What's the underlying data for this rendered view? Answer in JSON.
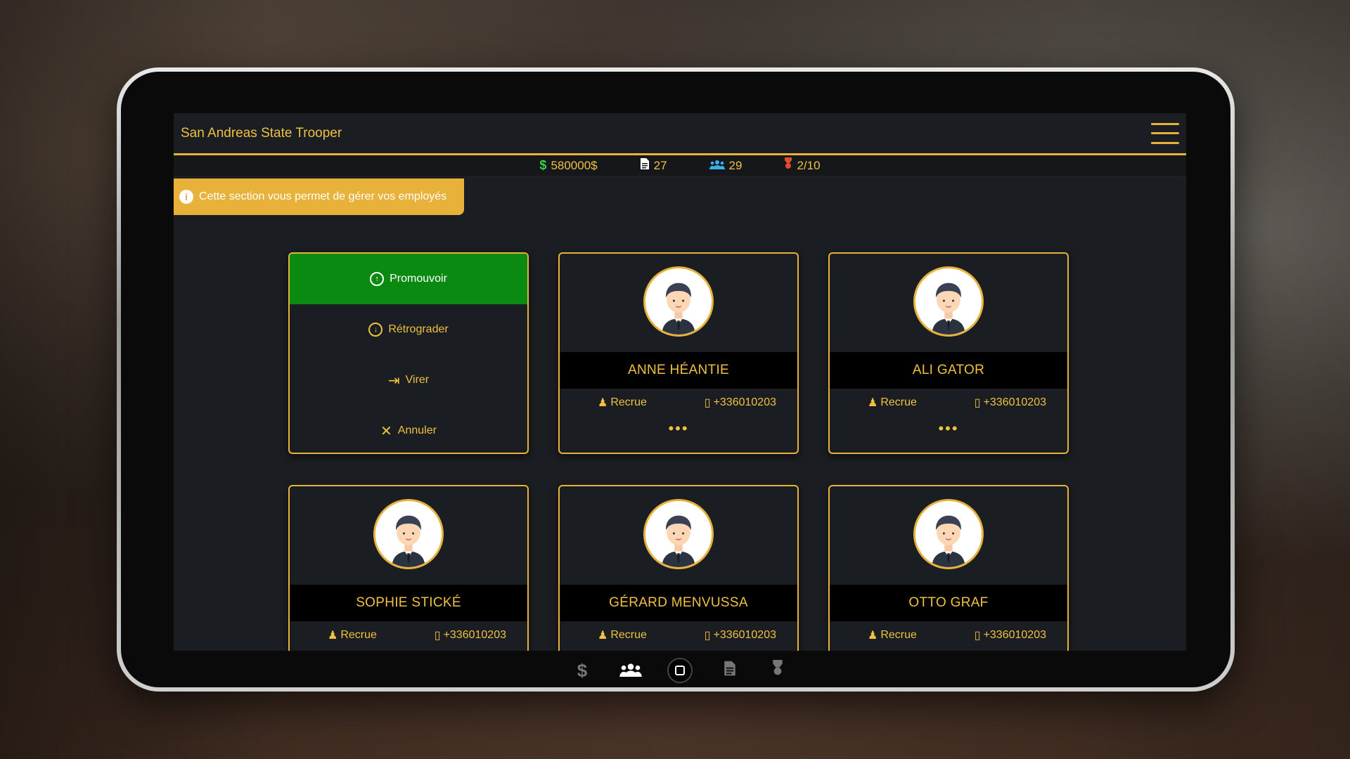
{
  "app": {
    "title": "San Andreas State Trooper"
  },
  "stats": {
    "money": "580000$",
    "documents": "27",
    "members": "29",
    "ranks": "2/10"
  },
  "banner": {
    "text": "Cette section vous permet de gérer vos employés"
  },
  "actions": {
    "promote": "Promouvoir",
    "demote": "Rétrograder",
    "fire": "Virer",
    "cancel": "Annuler"
  },
  "employees": [
    {
      "name": "ANNE HÉANTIE",
      "rank": "Recrue",
      "phone": "+336010203",
      "more": "•••"
    },
    {
      "name": "ALI GATOR",
      "rank": "Recrue",
      "phone": "+336010203",
      "more": "•••"
    },
    {
      "name": "SOPHIE STICKÉ",
      "rank": "Recrue",
      "phone": "+336010203",
      "more": "•••"
    },
    {
      "name": "GÉRARD MENVUSSA",
      "rank": "Recrue",
      "phone": "+336010203",
      "more": "•••"
    },
    {
      "name": "OTTO GRAF",
      "rank": "Recrue",
      "phone": "+336010203",
      "more": "•••"
    }
  ],
  "colors": {
    "accent": "#e8b23a",
    "active": "#0b8a12",
    "background": "#1a1d21"
  },
  "dock": {
    "items": [
      "dollar-icon",
      "team-icon",
      "home-button",
      "document-icon",
      "medal-icon"
    ]
  }
}
